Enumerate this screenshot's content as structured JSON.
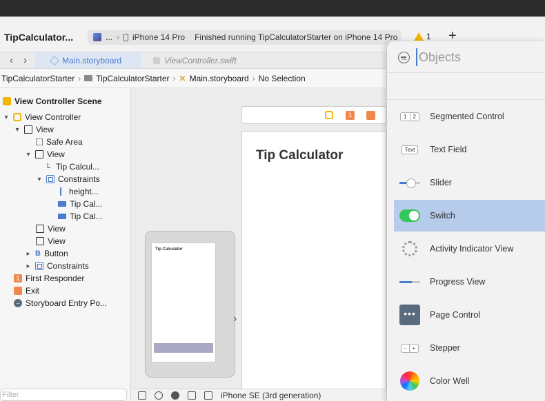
{
  "toolbar": {
    "project_title": "TipCalculator...",
    "scheme_ellipsis": "...",
    "device": "iPhone 14 Pro",
    "status": "Finished running TipCalculatorStarter on iPhone 14 Pro",
    "warning_count": "1",
    "add_label": "+"
  },
  "tabs": [
    {
      "label": "Main.storyboard"
    },
    {
      "label": "ViewController.swift"
    }
  ],
  "jumpbar": {
    "project": "TipCalculatorStarter",
    "group": "TipCalculatorStarter",
    "file": "Main.storyboard",
    "selection": "No Selection"
  },
  "outline": {
    "scene": "View Controller Scene",
    "rows": [
      {
        "label": "View Controller"
      },
      {
        "label": "View"
      },
      {
        "label": "Safe Area"
      },
      {
        "label": "View"
      },
      {
        "label": "Tip Calcul..."
      },
      {
        "label": "Constraints"
      },
      {
        "label": "height..."
      },
      {
        "label": "Tip Cal..."
      },
      {
        "label": "Tip Cal..."
      },
      {
        "label": "View"
      },
      {
        "label": "View"
      },
      {
        "label": "Button"
      },
      {
        "label": "Constraints"
      },
      {
        "label": "First Responder"
      },
      {
        "label": "Exit"
      },
      {
        "label": "Storyboard Entry Po..."
      }
    ],
    "filter_placeholder": "Filter"
  },
  "canvas": {
    "vc_title": "Tip Calculator",
    "mini_title": "Tip Calculator",
    "badge": "1",
    "device_label": "iPhone SE (3rd generation)"
  },
  "library": {
    "search_placeholder": "Objects",
    "items": [
      {
        "label": "Segmented Control",
        "thumb": [
          "1",
          "2"
        ]
      },
      {
        "label": "Text Field",
        "thumb": "Text"
      },
      {
        "label": "Slider"
      },
      {
        "label": "Switch"
      },
      {
        "label": "Activity Indicator View"
      },
      {
        "label": "Progress View"
      },
      {
        "label": "Page Control",
        "thumb": "•••"
      },
      {
        "label": "Stepper",
        "thumb": [
          "-",
          "+"
        ]
      },
      {
        "label": "Color Well"
      }
    ]
  }
}
